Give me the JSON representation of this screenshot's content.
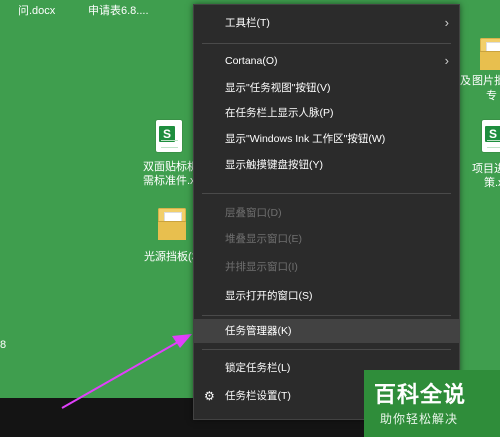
{
  "desktop": {
    "file_top_left": "问.docx",
    "file_top_mid": "申请表6.8....",
    "file_left_line1": "双面贴标机",
    "file_left_line2": "需标准件.xl",
    "folder_left": "光源挡板(3",
    "file_right_top_1": "及",
    "file_right_top_2": "图片批",
    "file_right_top_3": "专",
    "file_right_mid_1": "项目进",
    "file_right_mid_2": "策.x",
    "left_edge_text": "8"
  },
  "context_menu": {
    "items": [
      {
        "label": "工具栏(T)",
        "submenu": true,
        "disabled": false
      },
      {
        "label": "Cortana(O)",
        "submenu": true,
        "disabled": false
      },
      {
        "label": "显示\"任务视图\"按钮(V)",
        "submenu": false,
        "disabled": false
      },
      {
        "label": "在任务栏上显示人脉(P)",
        "submenu": false,
        "disabled": false
      },
      {
        "label": "显示\"Windows Ink 工作区\"按钮(W)",
        "submenu": false,
        "disabled": false
      },
      {
        "label": "显示触摸键盘按钮(Y)",
        "submenu": false,
        "disabled": false
      },
      {
        "label": "层叠窗口(D)",
        "submenu": false,
        "disabled": true
      },
      {
        "label": "堆叠显示窗口(E)",
        "submenu": false,
        "disabled": true
      },
      {
        "label": "并排显示窗口(I)",
        "submenu": false,
        "disabled": true
      },
      {
        "label": "显示打开的窗口(S)",
        "submenu": false,
        "disabled": false
      },
      {
        "label": "任务管理器(K)",
        "submenu": false,
        "disabled": false,
        "highlighted": true
      },
      {
        "label": "锁定任务栏(L)",
        "submenu": false,
        "disabled": false
      },
      {
        "label": "任务栏设置(T)",
        "submenu": false,
        "disabled": false,
        "icon": "gear-icon"
      }
    ],
    "chevron": "›",
    "gear": "⚙"
  },
  "watermark": {
    "title": "百科全说",
    "subtitle": "助你轻松解决"
  },
  "colors": {
    "desktop_bg": "#3f9e4e",
    "menu_bg": "#2b2b2b",
    "highlight": "#424242",
    "arrow": "#e040fb"
  }
}
